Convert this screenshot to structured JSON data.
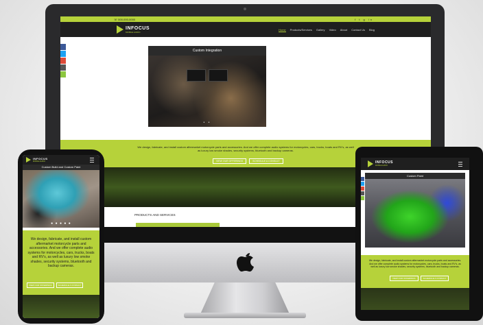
{
  "desktop": {
    "topbar": {
      "phone": "☏ 000-000-0000",
      "social": "f t g in"
    },
    "logo": {
      "name": "INFOCUS",
      "tagline": "MOBILE AUDIO"
    },
    "nav": [
      "Home",
      "Products/Services",
      "Gallery",
      "Video",
      "About",
      "Contact Us",
      "Blog"
    ],
    "slide_title": "Custom Integration",
    "slide_dots": "• •",
    "intro_text": "We design, fabricate, and install custom aftermarket motorcycle parts and accessories. And we offer complete audio systems for motorcycles, cars, trucks, boats and RV's, as well as luxury low smoke shades, security systems, bluetooth and backup cameras.",
    "cta_primary": "VIEW OUR OFFERINGS",
    "cta_secondary": "SCHEDULE A CONSULT",
    "products_heading": "PRODUCTS AND SERVICES"
  },
  "phone": {
    "slide_title": "Custom Build and Custom Paint",
    "slide_dots": "● ● ● ● ●",
    "intro_text": "We design, fabricate, and install custom aftermarket motorcycle parts and accessories. And we offer complete audio systems for motorcycles, cars, trucks, boats and RV's, as well as luxury low smoke shades, security systems, bluetooth and backup cameras.",
    "cta_primary": "VIEW OUR OFFERINGS",
    "cta_secondary": "SCHEDULE A CONSULT"
  },
  "tablet": {
    "slide_title": "Custom Paint",
    "intro_text": "We design, fabricate, and install custom aftermarket motorcycle parts and accessories. And we offer complete audio systems for motorcycles, cars, trucks, boats and RV's, as well as luxury low smoke shades, security systems, bluetooth and backup cameras.",
    "cta_primary": "VIEW OUR OFFERINGS",
    "cta_secondary": "SCHEDULE A CONSULT"
  },
  "colors": {
    "accent": "#b6d23a",
    "dark": "#1f1f1f"
  },
  "icons": [
    "apple-logo-icon",
    "menu-icon",
    "facebook-icon",
    "twitter-icon",
    "googleplus-icon",
    "youtube-icon",
    "share-icon"
  ]
}
